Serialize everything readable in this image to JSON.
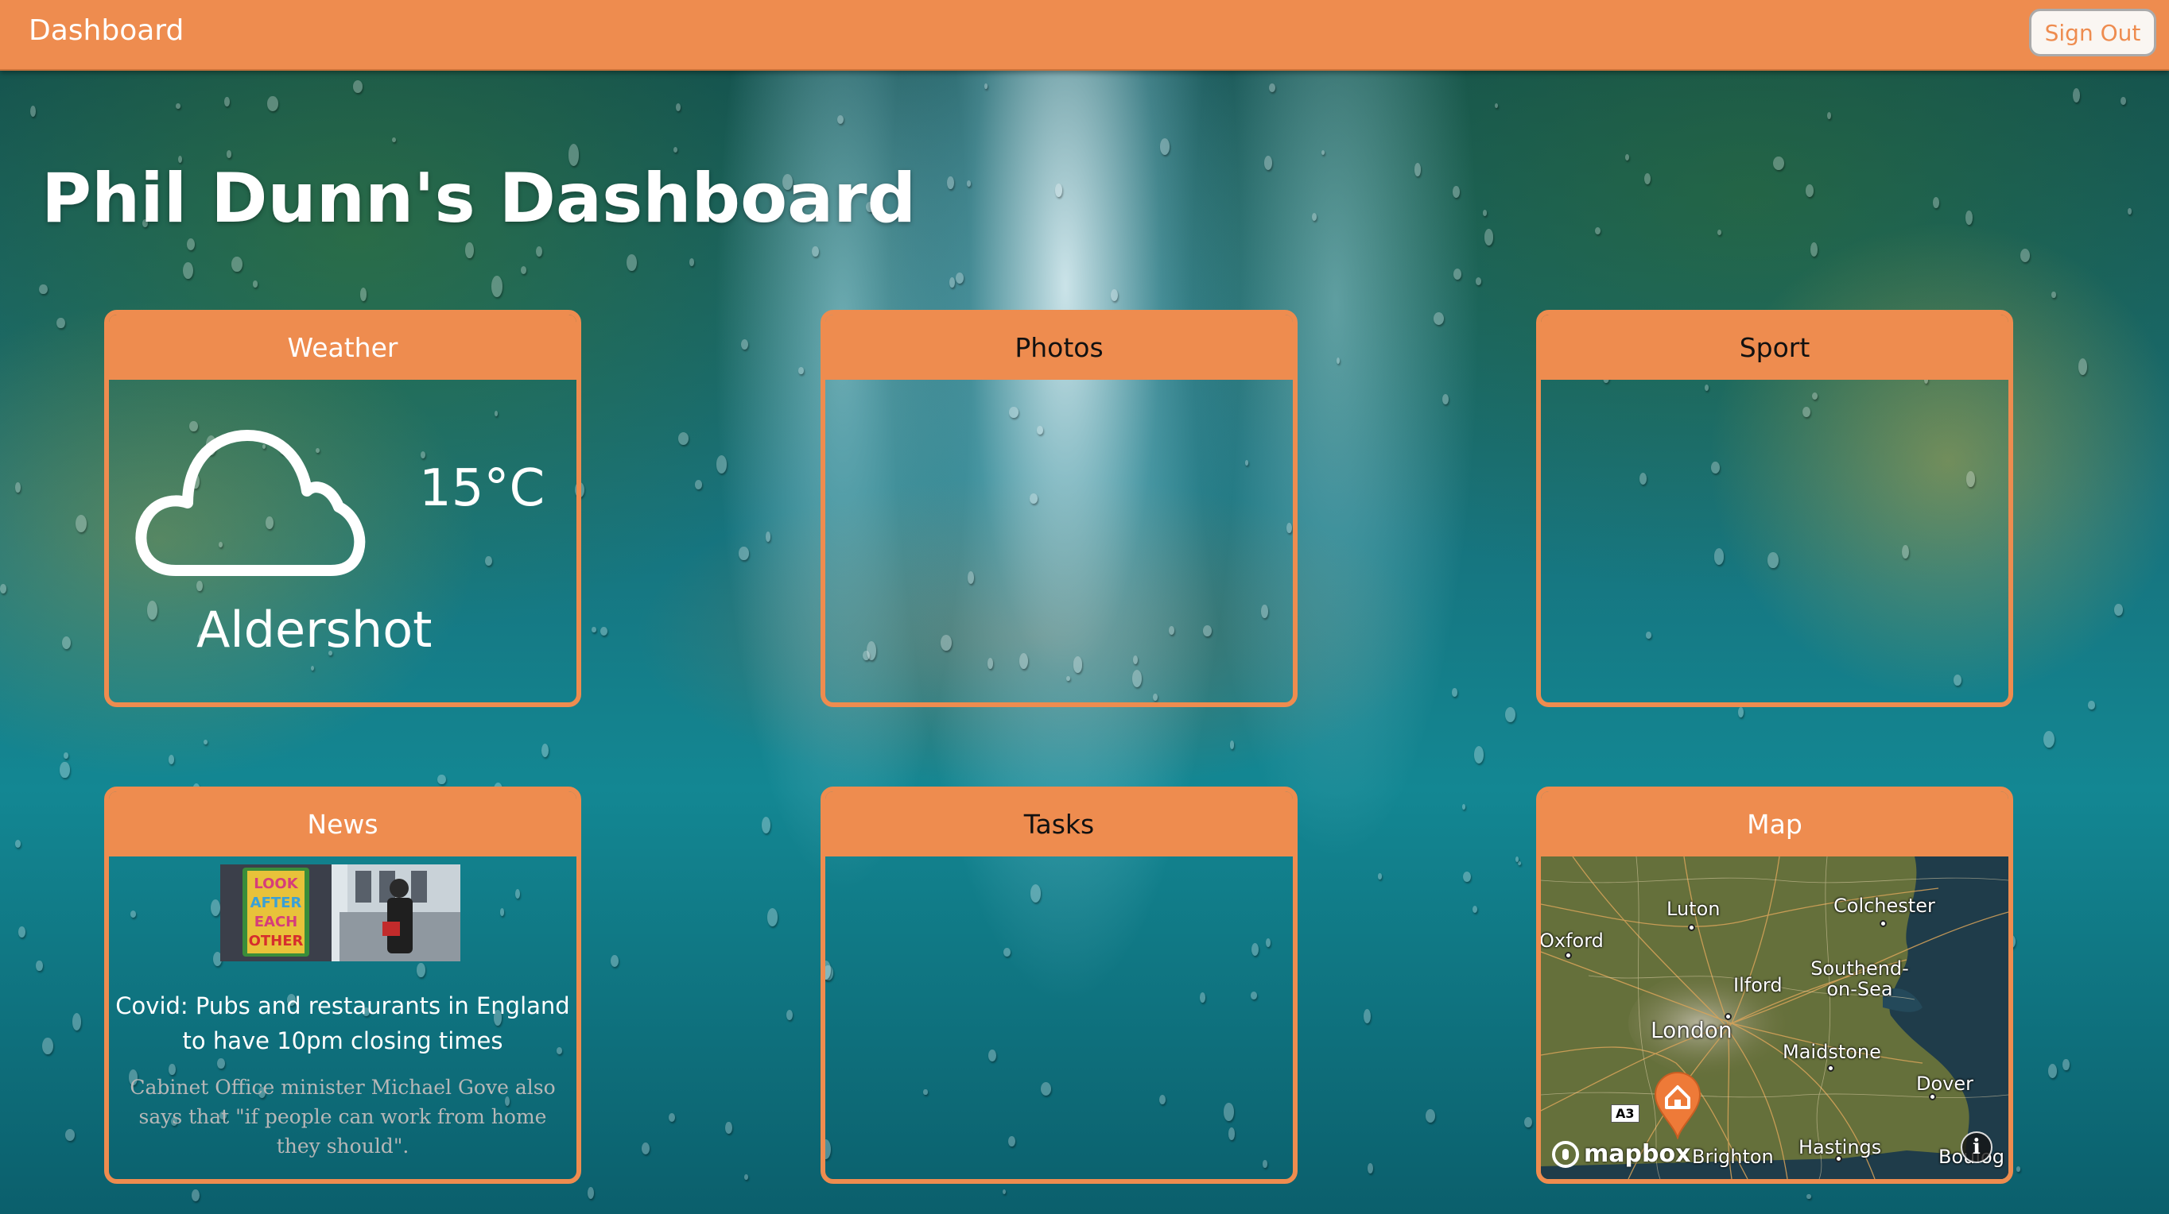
{
  "topbar": {
    "brand": "Dashboard",
    "signout_label": "Sign Out"
  },
  "page": {
    "title": "Phil Dunn's Dashboard"
  },
  "cards": {
    "weather": {
      "title": "Weather",
      "icon": "cloud-icon",
      "temperature": "15°C",
      "location": "Aldershot"
    },
    "photos": {
      "title": "Photos"
    },
    "sport": {
      "title": "Sport"
    },
    "news": {
      "title": "News",
      "image_poster_text": "LOOK AFTER EACH OTHER",
      "headline": "Covid: Pubs and restaurants in England to have 10pm closing times",
      "description": "Cabinet Office minister Michael Gove also says that \"if people can work from home they should\"."
    },
    "tasks": {
      "title": "Tasks"
    },
    "map": {
      "title": "Map",
      "places": [
        "Luton",
        "Colchester",
        "Oxford",
        "Southend-on-Sea",
        "Ilford",
        "London",
        "Maidstone",
        "Dover",
        "Brighton",
        "Hastings",
        "Boulog"
      ],
      "road_label": "A3",
      "attribution": "mapbox",
      "info_glyph": "i",
      "marker_icon": "home-pin-icon"
    }
  },
  "colors": {
    "accent": "#ee8c4f",
    "card_border": "#ee8c4f",
    "header_text_white": "#ffffff",
    "header_text_dark": "#111111"
  }
}
